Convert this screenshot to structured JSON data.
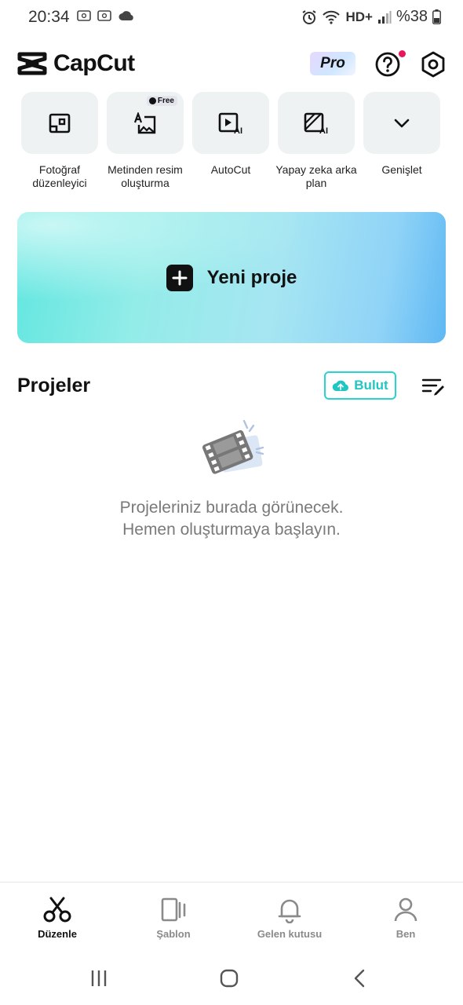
{
  "status_bar": {
    "time": "20:34",
    "network": "HD+",
    "battery": "%38"
  },
  "header": {
    "app_name": "CapCut",
    "pro_label": "Pro"
  },
  "tools": [
    {
      "label": "Fotoğraf düzenleyici",
      "icon": "photo-editor-icon"
    },
    {
      "label": "Metinden resim oluşturma",
      "icon": "text-to-image-icon",
      "badge": "Free"
    },
    {
      "label": "AutoCut",
      "icon": "autocut-icon"
    },
    {
      "label": "Yapay zeka arka plan",
      "icon": "ai-background-icon"
    },
    {
      "label": "Genişlet",
      "icon": "chevron-down-icon"
    }
  ],
  "new_project": {
    "label": "Yeni proje"
  },
  "projects": {
    "title": "Projeler",
    "cloud_label": "Bulut",
    "empty_line1": "Projeleriniz burada görünecek.",
    "empty_line2": "Hemen oluşturmaya başlayın."
  },
  "bottom_nav": [
    {
      "label": "Düzenle",
      "icon": "scissors-icon",
      "active": true
    },
    {
      "label": "Şablon",
      "icon": "template-icon",
      "active": false
    },
    {
      "label": "Gelen kutusu",
      "icon": "bell-icon",
      "active": false
    },
    {
      "label": "Ben",
      "icon": "profile-icon",
      "active": false
    }
  ],
  "colors": {
    "accent": "#27d4cf",
    "notification_dot": "#e8175d"
  }
}
